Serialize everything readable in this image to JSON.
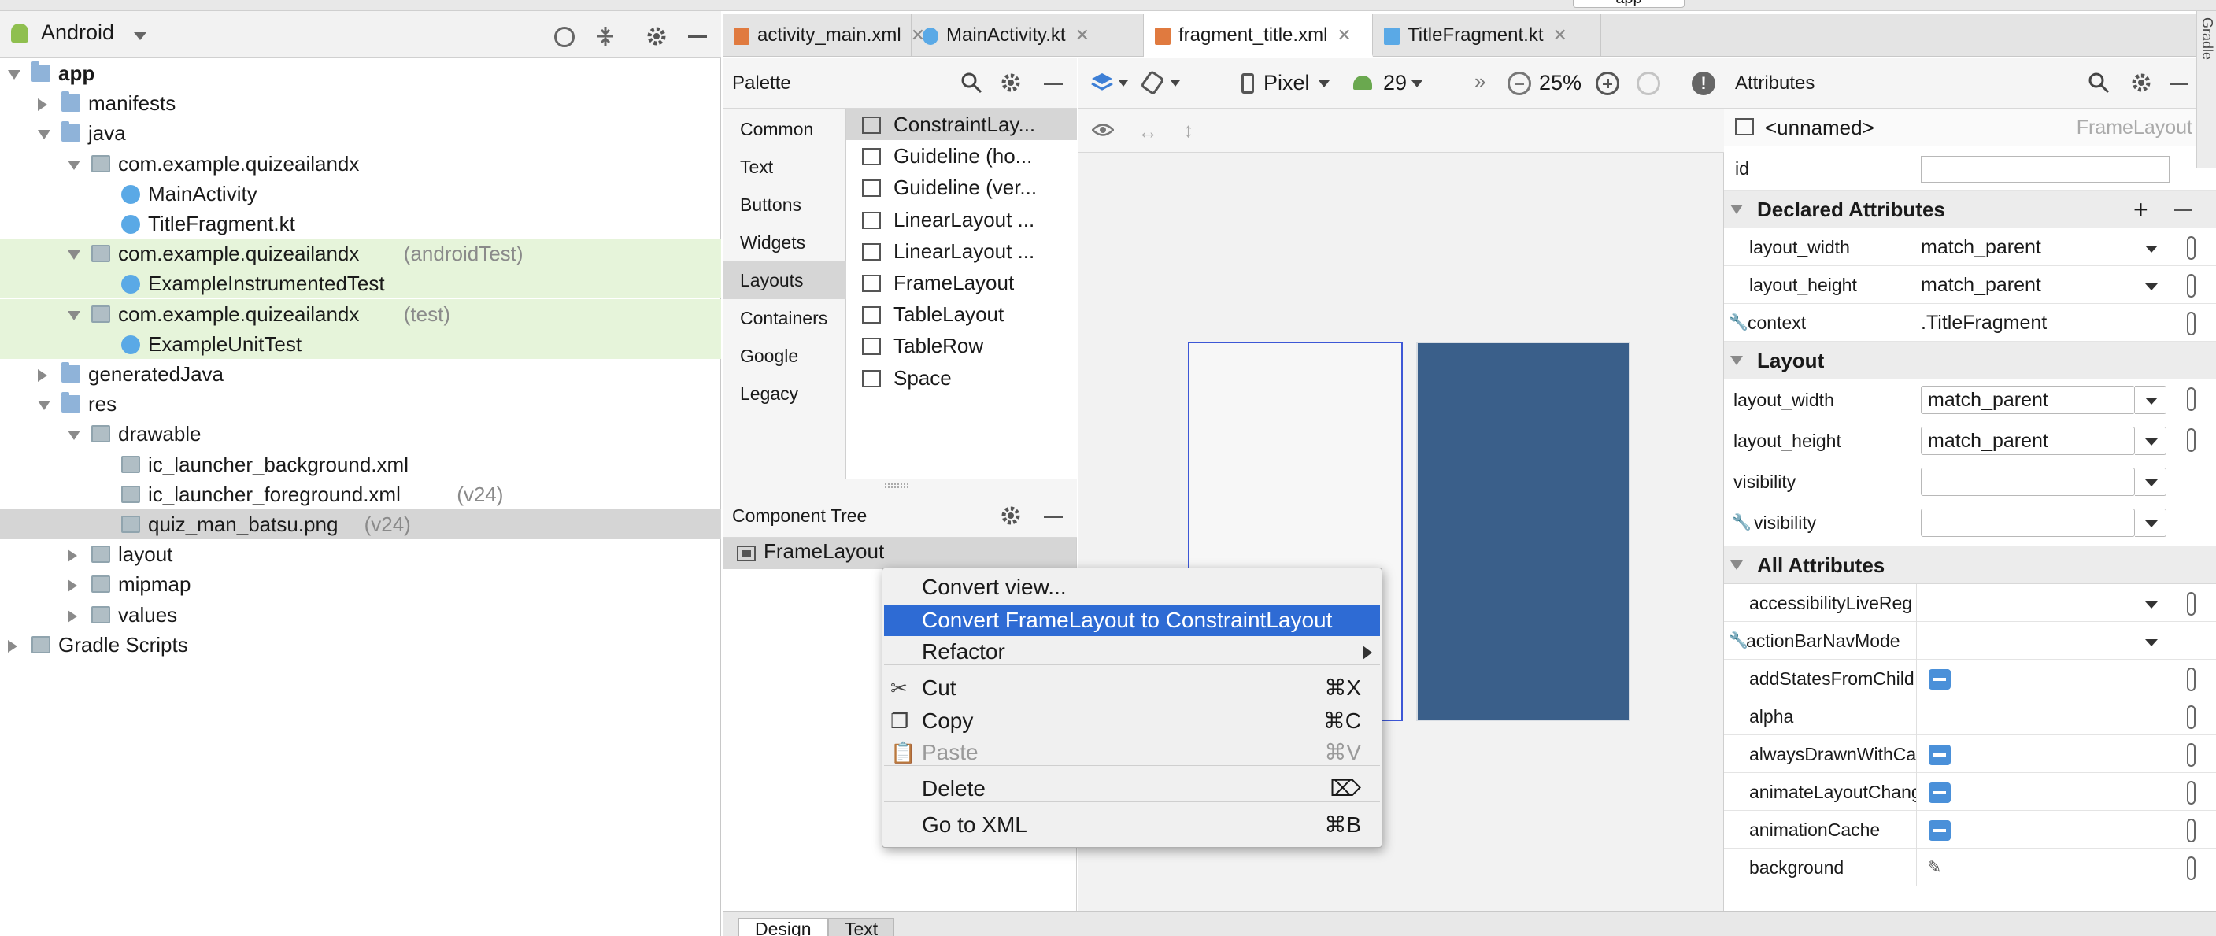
{
  "top_strip": {
    "app_label": "app"
  },
  "project_panel": {
    "view_selector": "Android",
    "tree": [
      {
        "label": "app",
        "bold": true,
        "depth": 0,
        "expanded": true,
        "icon": "module-folder-icon"
      },
      {
        "label": "manifests",
        "depth": 1,
        "expanded": false,
        "icon": "folder-icon"
      },
      {
        "label": "java",
        "depth": 1,
        "expanded": true,
        "icon": "folder-icon"
      },
      {
        "label": "com.example.quizeailandx",
        "depth": 2,
        "expanded": true,
        "icon": "package-icon"
      },
      {
        "label": "MainActivity",
        "depth": 3,
        "icon": "kotlin-class-icon"
      },
      {
        "label": "TitleFragment.kt",
        "depth": 3,
        "icon": "kotlin-file-icon"
      },
      {
        "label": "com.example.quizeailandx",
        "suffix": "(androidTest)",
        "depth": 2,
        "expanded": true,
        "icon": "package-icon",
        "highlight": "green"
      },
      {
        "label": "ExampleInstrumentedTest",
        "depth": 3,
        "icon": "kotlin-class-icon",
        "highlight": "green"
      },
      {
        "label": "com.example.quizeailandx",
        "suffix": "(test)",
        "depth": 2,
        "expanded": true,
        "icon": "package-icon",
        "highlight": "green"
      },
      {
        "label": "ExampleUnitTest",
        "depth": 3,
        "icon": "kotlin-class-icon",
        "highlight": "green"
      },
      {
        "label": "generatedJava",
        "depth": 1,
        "expanded": false,
        "icon": "generated-folder-icon"
      },
      {
        "label": "res",
        "depth": 1,
        "expanded": true,
        "icon": "res-folder-icon"
      },
      {
        "label": "drawable",
        "depth": 2,
        "expanded": true,
        "icon": "package-icon"
      },
      {
        "label": "ic_launcher_background.xml",
        "depth": 3,
        "icon": "xml-file-icon"
      },
      {
        "label": "ic_launcher_foreground.xml",
        "suffix": "(v24)",
        "depth": 3,
        "icon": "xml-file-icon"
      },
      {
        "label": "quiz_man_batsu.png",
        "suffix": "(v24)",
        "depth": 3,
        "icon": "image-file-icon",
        "highlight": "selected"
      },
      {
        "label": "layout",
        "depth": 2,
        "expanded": false,
        "icon": "package-icon"
      },
      {
        "label": "mipmap",
        "depth": 2,
        "expanded": false,
        "icon": "package-icon"
      },
      {
        "label": "values",
        "depth": 2,
        "expanded": false,
        "icon": "package-icon"
      },
      {
        "label": "Gradle Scripts",
        "depth": 0,
        "expanded": false,
        "icon": "gradle-icon"
      }
    ]
  },
  "editor_tabs": [
    {
      "label": "activity_main.xml",
      "icon": "xml-file-icon",
      "active": false
    },
    {
      "label": "MainActivity.kt",
      "icon": "kotlin-class-icon",
      "active": false
    },
    {
      "label": "fragment_title.xml",
      "icon": "xml-file-icon",
      "active": true
    },
    {
      "label": "TitleFragment.kt",
      "icon": "kotlin-file-icon",
      "active": false
    }
  ],
  "palette": {
    "title": "Palette",
    "categories": [
      "Common",
      "Text",
      "Buttons",
      "Widgets",
      "Layouts",
      "Containers",
      "Google",
      "Legacy"
    ],
    "selected_category": "Layouts",
    "items": [
      "ConstraintLay...",
      "Guideline (ho...",
      "Guideline (ver...",
      "LinearLayout ...",
      "LinearLayout ...",
      "FrameLayout",
      "TableLayout",
      "TableRow",
      "Space"
    ],
    "item_icons": [
      "constraint-icon",
      "guideline-horizontal-icon",
      "guideline-vertical-icon",
      "linearlayout-horizontal-icon",
      "linearlayout-vertical-icon",
      "framelayout-icon",
      "tablelayout-icon",
      "tablerow-icon",
      "space-icon"
    ]
  },
  "component_tree": {
    "title": "Component Tree",
    "root": "FrameLayout"
  },
  "design_toolbar": {
    "device": "Pixel",
    "api": "29",
    "zoom": "25%"
  },
  "attributes": {
    "title": "Attributes",
    "component_name": "<unnamed>",
    "component_type": "FrameLayout",
    "id_label": "id",
    "declared_section": "Declared Attributes",
    "declared": [
      {
        "name": "layout_width",
        "value": "match_parent"
      },
      {
        "name": "layout_height",
        "value": "match_parent"
      },
      {
        "name": "context",
        "value": ".TitleFragment"
      }
    ],
    "layout_section": "Layout",
    "layout": [
      {
        "name": "layout_width",
        "value": "match_parent"
      },
      {
        "name": "layout_height",
        "value": "match_parent"
      },
      {
        "name": "visibility",
        "value": ""
      },
      {
        "name": "visibility",
        "value": ""
      }
    ],
    "all_section": "All Attributes",
    "all": [
      "accessibilityLiveReg",
      "actionBarNavMode",
      "addStatesFromChild",
      "alpha",
      "alwaysDrawnWithCa",
      "animateLayoutChang",
      "animationCache",
      "background"
    ]
  },
  "context_menu": {
    "items": [
      {
        "label": "Convert view...",
        "shortcut": ""
      },
      {
        "label": "Convert FrameLayout to ConstraintLayout",
        "shortcut": "",
        "highlighted": true
      },
      {
        "label": "Refactor",
        "shortcut": "",
        "submenu": true
      },
      {
        "label": "Cut",
        "shortcut": "⌘X",
        "icon": "scissors-icon"
      },
      {
        "label": "Copy",
        "shortcut": "⌘C",
        "icon": "copy-icon"
      },
      {
        "label": "Paste",
        "shortcut": "⌘V",
        "icon": "paste-icon",
        "disabled": true
      },
      {
        "label": "Delete",
        "shortcut": "⌦"
      },
      {
        "label": "Go to XML",
        "shortcut": "⌘B"
      }
    ]
  },
  "bottom_tabs": [
    "Design",
    "Text"
  ],
  "side_strip": {
    "label": "Gradle"
  },
  "colors": {
    "accent_blue": "#2e6bd4",
    "blueprint_fill": "#3a5f8a",
    "test_highlight": "#e6f4da"
  }
}
